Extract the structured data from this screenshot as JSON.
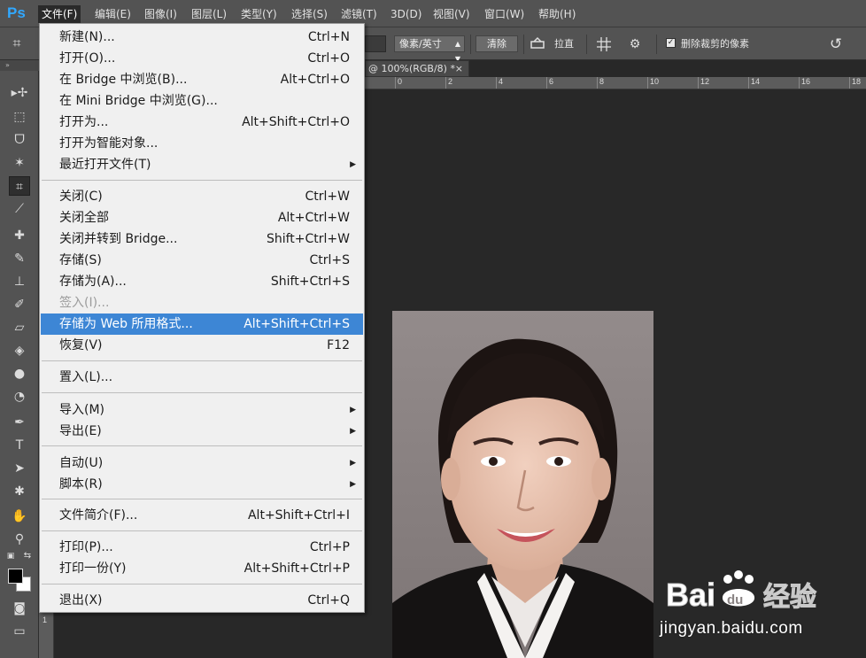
{
  "app": {
    "logo": "Ps"
  },
  "menubar": {
    "items": [
      {
        "label": "文件(F)"
      },
      {
        "label": "编辑(E)"
      },
      {
        "label": "图像(I)"
      },
      {
        "label": "图层(L)"
      },
      {
        "label": "类型(Y)"
      },
      {
        "label": "选择(S)"
      },
      {
        "label": "滤镜(T)"
      },
      {
        "label": "3D(D)"
      },
      {
        "label": "视图(V)"
      },
      {
        "label": "窗口(W)"
      },
      {
        "label": "帮助(H)"
      }
    ]
  },
  "options": {
    "unit_select": "像素/英寸",
    "clear_button": "清除",
    "straighten_label": "拉直",
    "delete_cropped_label": "删除裁剪的像素",
    "delete_cropped_checked": true
  },
  "document": {
    "tab_title": "@ 100%(RGB/8) *",
    "tab_close": "×",
    "ruler_top": [
      "0",
      "2",
      "4",
      "6",
      "8",
      "10",
      "12",
      "14",
      "16",
      "18"
    ],
    "ruler_left": [
      "1"
    ]
  },
  "file_menu": {
    "items": [
      {
        "label": "新建(N)...",
        "shortcut": "Ctrl+N"
      },
      {
        "label": "打开(O)...",
        "shortcut": "Ctrl+O"
      },
      {
        "label": "在 Bridge 中浏览(B)...",
        "shortcut": "Alt+Ctrl+O"
      },
      {
        "label": "在 Mini Bridge 中浏览(G)...",
        "shortcut": ""
      },
      {
        "label": "打开为...",
        "shortcut": "Alt+Shift+Ctrl+O"
      },
      {
        "label": "打开为智能对象...",
        "shortcut": ""
      },
      {
        "label": "最近打开文件(T)",
        "shortcut": ""
      },
      {
        "label": "关闭(C)",
        "shortcut": "Ctrl+W"
      },
      {
        "label": "关闭全部",
        "shortcut": "Alt+Ctrl+W"
      },
      {
        "label": "关闭并转到 Bridge...",
        "shortcut": "Shift+Ctrl+W"
      },
      {
        "label": "存储(S)",
        "shortcut": "Ctrl+S"
      },
      {
        "label": "存储为(A)...",
        "shortcut": "Shift+Ctrl+S"
      },
      {
        "label": "签入(I)...",
        "shortcut": ""
      },
      {
        "label": "存储为 Web 所用格式...",
        "shortcut": "Alt+Shift+Ctrl+S"
      },
      {
        "label": "恢复(V)",
        "shortcut": "F12"
      },
      {
        "label": "置入(L)...",
        "shortcut": ""
      },
      {
        "label": "导入(M)",
        "shortcut": ""
      },
      {
        "label": "导出(E)",
        "shortcut": ""
      },
      {
        "label": "自动(U)",
        "shortcut": ""
      },
      {
        "label": "脚本(R)",
        "shortcut": ""
      },
      {
        "label": "文件简介(F)...",
        "shortcut": "Alt+Shift+Ctrl+I"
      },
      {
        "label": "打印(P)...",
        "shortcut": "Ctrl+P"
      },
      {
        "label": "打印一份(Y)",
        "shortcut": "Alt+Shift+Ctrl+P"
      },
      {
        "label": "退出(X)",
        "shortcut": "Ctrl+Q"
      }
    ]
  },
  "watermark": {
    "logo_text": "Bai 经验",
    "logo_du": "du",
    "url": "jingyan.baidu.com"
  },
  "colors": {
    "menu_highlight": "#3d86d5",
    "ps_blue": "#31a8ff",
    "canvas_bg": "#282828"
  }
}
